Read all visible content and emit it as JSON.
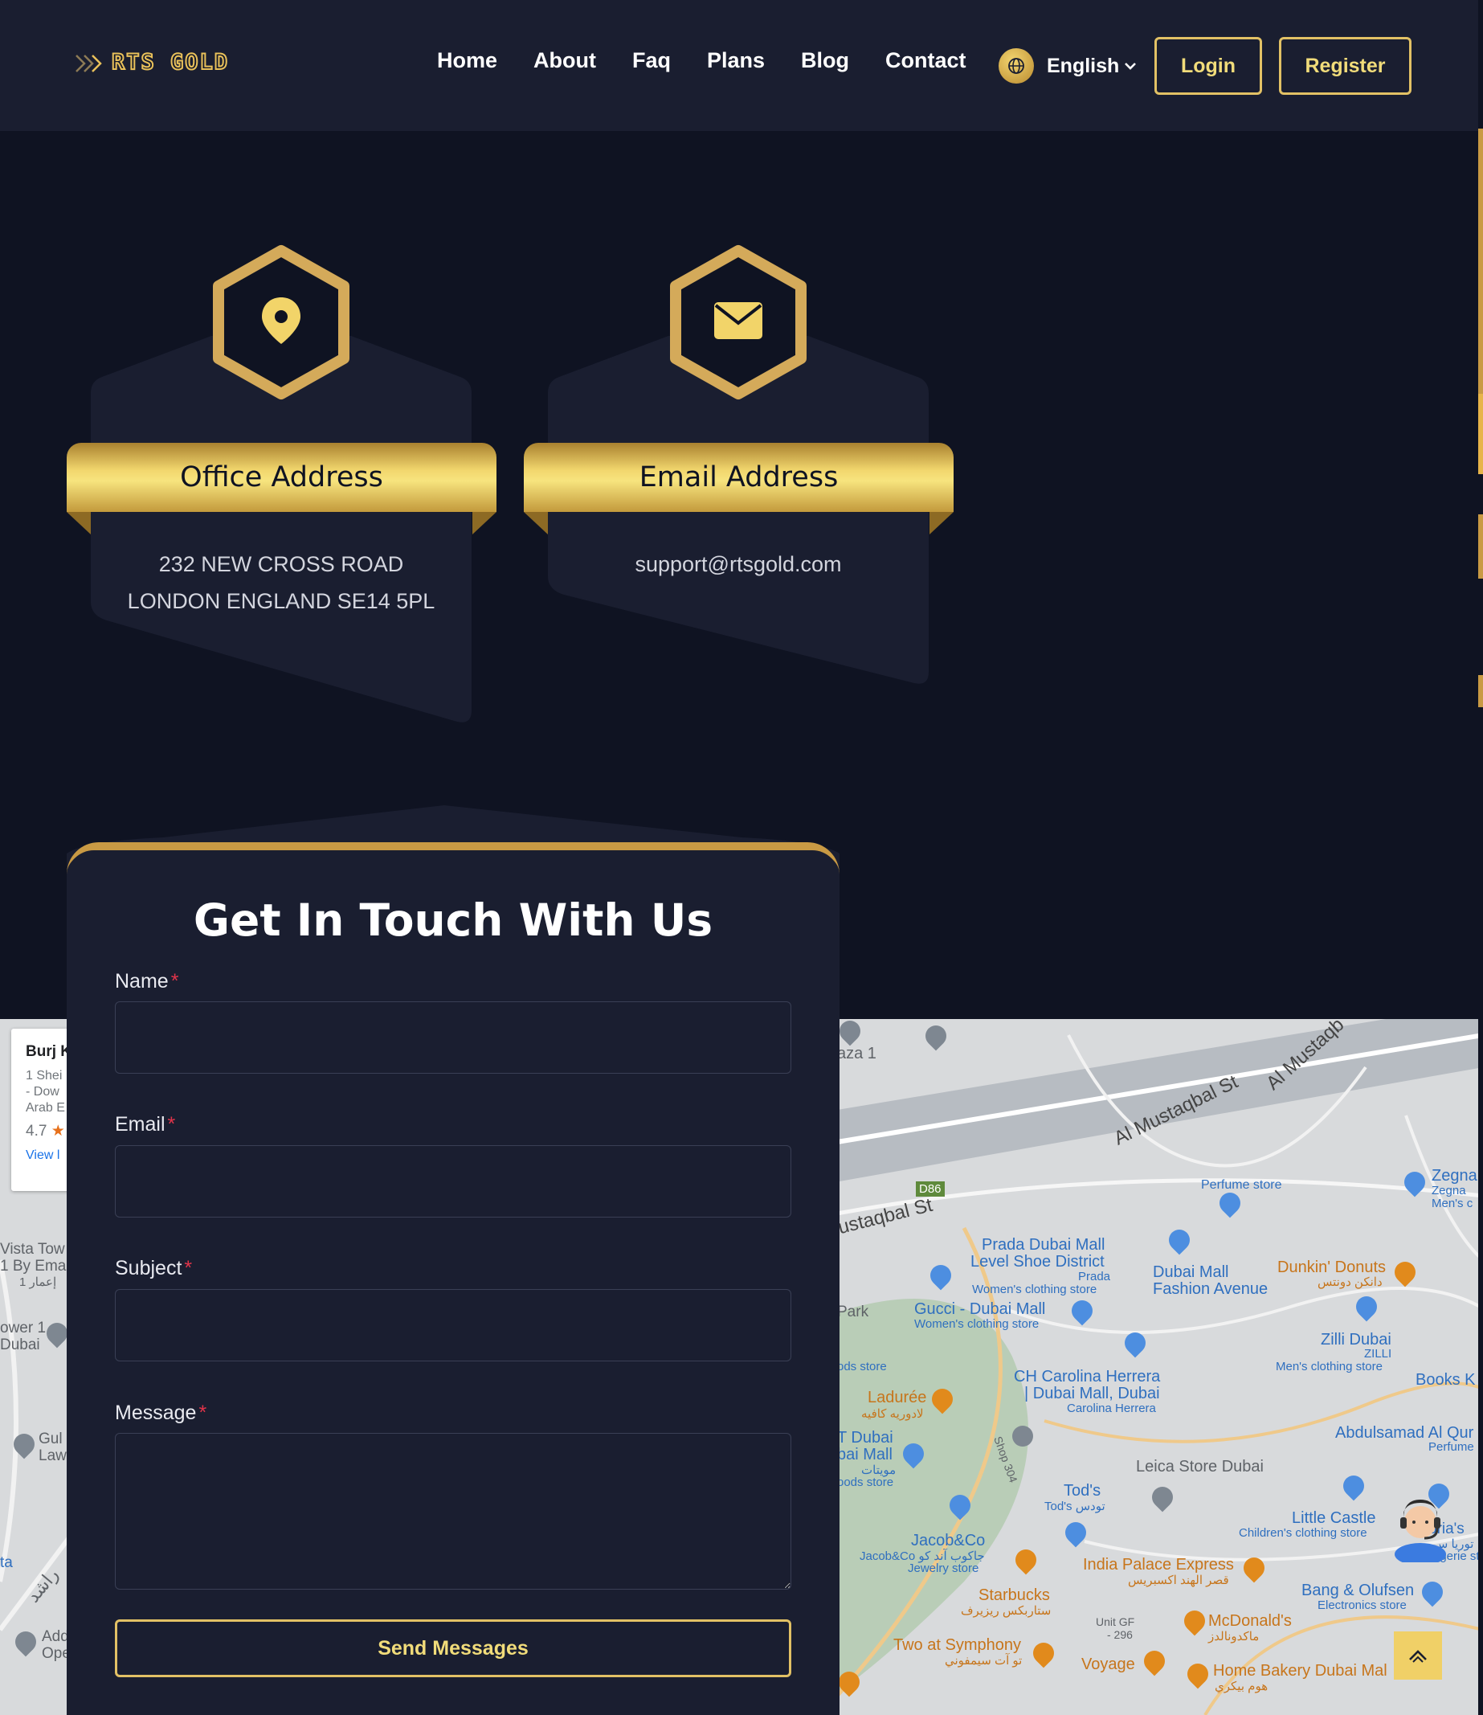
{
  "header": {
    "logo_text": "RTS GOLD",
    "nav": [
      "Home",
      "About",
      "Faq",
      "Plans",
      "Blog",
      "Contact"
    ],
    "language": "English",
    "login_label": "Login",
    "register_label": "Register"
  },
  "cards": {
    "office": {
      "title": "Office Address",
      "line1": "232 NEW CROSS ROAD",
      "line2": "LONDON ENGLAND SE14 5PL"
    },
    "email": {
      "title": "Email Address",
      "line1": "support@rtsgold.com"
    }
  },
  "contact_form": {
    "title": "Get In Touch With Us",
    "name_label": "Name",
    "email_label": "Email",
    "subject_label": "Subject",
    "message_label": "Message",
    "required_mark": "*",
    "submit_label": "Send Messages"
  },
  "map": {
    "info_card": {
      "title": "Burj K",
      "line1": "1 Shei",
      "line2": "- Dow",
      "line3": "Arab E",
      "rating": "4.7",
      "link": "View l"
    },
    "labels": {
      "plaza": "aza 1",
      "street1": "Al Mustaqbal St",
      "street2": "Al Mustaqb",
      "street3": "ustaqbal St",
      "road_code": "D86",
      "perfume_store": "Perfume store",
      "zegna": "Zegna",
      "zegna_sub": "Zegna",
      "zegna_cat": "Men's c",
      "prada": "Prada Dubai Mall",
      "prada2": "Level Shoe District",
      "prada_sub": "Prada",
      "prada_cat": "Women's clothing store",
      "dubai_mall_fa": "Dubai Mall",
      "dubai_mall_fa2": "Fashion Avenue",
      "dunkin": "Dunkin' Donuts",
      "dunkin_ar": "دانكن دونتس",
      "park": "Park",
      "gucci": "Gucci - Dubai Mall",
      "gucci_cat": "Women's clothing store",
      "zilli": "Zilli Dubai",
      "zilli_sub": "ZILLI",
      "zilli_cat": "Men's clothing store",
      "goods_store": "ods store",
      "ch": "CH Carolina Herrera",
      "ch2": "| Dubai Mall, Dubai",
      "ch_sub": "Carolina Herrera",
      "books": "Books K",
      "laduree": "Ladurée",
      "laduree_ar": "لادوريه كافيه",
      "abdulsamad": "Abdulsamad Al Qur",
      "abdulsamad_cat": "Perfume",
      "t_dubai": "T Dubai",
      "t_dubai2": "bai Mall",
      "t_dubai_ar": "مويتات",
      "t_dubai_cat": "oods store",
      "shop": "Shop 304",
      "leica": "Leica Store Dubai",
      "tods": "Tod's",
      "tods2": "Tod's تودس",
      "little_castle": "Little Castle",
      "little_castle_cat": "Children's clothing store",
      "victoria": "oria's",
      "victoria_ar": "توريا س",
      "victoria_cat": "ngerie sto",
      "jacob": "Jacob&Co",
      "jacob2": "Jacob&Co جاكوب آند كو",
      "jacob_cat": "Jewelry store",
      "india_palace": "India Palace Express",
      "india_palace_ar": "قصر الهند اكسبريس",
      "bang": "Bang & Olufsen",
      "bang_cat": "Electronics store",
      "starbucks": "Starbucks",
      "starbucks_ar": "ستاربكس ريزيرف",
      "mcd": "McDonald's",
      "mcd_ar": "ماكدونالدز",
      "unit": "Unit GF",
      "unit2": "- 296",
      "two_sym": "Two at Symphony",
      "two_sym_ar": "تو آت سيمفوني",
      "voyage": "Voyage",
      "home_bakery": "Home Bakery Dubai Mal",
      "home_bakery_ar": "هوم بيكري",
      "vista": "Vista Tow",
      "vista2": "1 By Ema",
      "vista_ar": "إعمار 1",
      "tower": "ower 1",
      "tower2": "Dubai",
      "gulf": "Gul",
      "gulf2": "Law",
      "ta": "ta",
      "rashid": "راشد",
      "add": "Add",
      "add2": "Ope"
    }
  },
  "colors": {
    "gold": "#e2c165",
    "navy": "#1a1e30",
    "page": "#0f1322",
    "required": "#e0344a"
  }
}
